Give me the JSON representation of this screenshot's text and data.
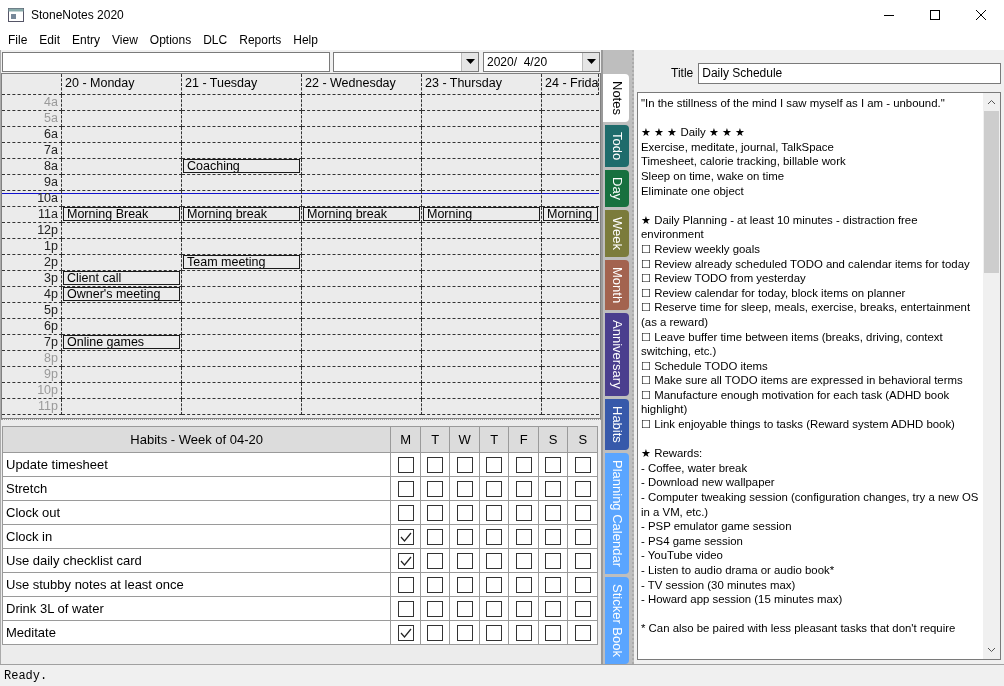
{
  "window": {
    "title": "StoneNotes 2020"
  },
  "menu": [
    "File",
    "Edit",
    "Entry",
    "View",
    "Options",
    "DLC",
    "Reports",
    "Help"
  ],
  "toolbar": {
    "date": "2020/  4/20"
  },
  "calendar": {
    "days": [
      "20 - Monday",
      "21 - Tuesday",
      "22 - Wednesday",
      "23 - Thursday",
      "24 - Frida"
    ],
    "rows": [
      {
        "time": "4a",
        "dimmed": true,
        "current": false,
        "slots": [
          {
            "kind": "empty"
          },
          {
            "kind": "empty"
          },
          {
            "kind": "empty"
          },
          {
            "kind": "empty"
          },
          {
            "kind": "empty"
          }
        ]
      },
      {
        "time": "5a",
        "dimmed": true,
        "current": false,
        "slots": [
          {
            "kind": "empty"
          },
          {
            "kind": "empty"
          },
          {
            "kind": "empty"
          },
          {
            "kind": "empty"
          },
          {
            "kind": "empty"
          }
        ]
      },
      {
        "time": "6a",
        "dimmed": false,
        "current": false,
        "slots": [
          {
            "kind": "empty"
          },
          {
            "kind": "empty"
          },
          {
            "kind": "empty"
          },
          {
            "kind": "empty"
          },
          {
            "kind": "empty"
          }
        ]
      },
      {
        "time": "7a",
        "dimmed": false,
        "current": false,
        "slots": [
          {
            "kind": "empty"
          },
          {
            "kind": "empty"
          },
          {
            "kind": "empty"
          },
          {
            "kind": "empty"
          },
          {
            "kind": "empty"
          }
        ]
      },
      {
        "time": "8a",
        "dimmed": false,
        "current": false,
        "slots": [
          {
            "kind": "empty"
          },
          {
            "kind": "event",
            "title": "Coaching"
          },
          {
            "kind": "empty"
          },
          {
            "kind": "empty"
          },
          {
            "kind": "empty"
          }
        ]
      },
      {
        "time": "9a",
        "dimmed": false,
        "current": false,
        "slots": [
          {
            "kind": "empty"
          },
          {
            "kind": "empty"
          },
          {
            "kind": "empty"
          },
          {
            "kind": "empty"
          },
          {
            "kind": "empty"
          }
        ]
      },
      {
        "time": "10a",
        "dimmed": false,
        "current": true,
        "slots": [
          {
            "kind": "empty"
          },
          {
            "kind": "empty"
          },
          {
            "kind": "empty"
          },
          {
            "kind": "empty"
          },
          {
            "kind": "empty"
          }
        ]
      },
      {
        "time": "11a",
        "dimmed": false,
        "current": false,
        "slots": [
          {
            "kind": "event",
            "title": "Morning Break"
          },
          {
            "kind": "event",
            "title": "Morning break"
          },
          {
            "kind": "event",
            "title": "Morning break"
          },
          {
            "kind": "event",
            "title": "Morning"
          },
          {
            "kind": "event",
            "title": "Morning"
          }
        ]
      },
      {
        "time": "12p",
        "dimmed": false,
        "current": false,
        "slots": [
          {
            "kind": "empty"
          },
          {
            "kind": "empty"
          },
          {
            "kind": "empty"
          },
          {
            "kind": "empty"
          },
          {
            "kind": "empty"
          }
        ]
      },
      {
        "time": "1p",
        "dimmed": false,
        "current": false,
        "slots": [
          {
            "kind": "empty"
          },
          {
            "kind": "empty"
          },
          {
            "kind": "empty"
          },
          {
            "kind": "empty"
          },
          {
            "kind": "empty"
          }
        ]
      },
      {
        "time": "2p",
        "dimmed": false,
        "current": false,
        "slots": [
          {
            "kind": "empty"
          },
          {
            "kind": "event",
            "title": "Team meeting"
          },
          {
            "kind": "empty"
          },
          {
            "kind": "empty"
          },
          {
            "kind": "empty"
          }
        ]
      },
      {
        "time": "3p",
        "dimmed": false,
        "current": false,
        "slots": [
          {
            "kind": "event",
            "title": "Client call"
          },
          {
            "kind": "empty"
          },
          {
            "kind": "empty"
          },
          {
            "kind": "empty"
          },
          {
            "kind": "empty"
          }
        ]
      },
      {
        "time": "4p",
        "dimmed": false,
        "current": false,
        "slots": [
          {
            "kind": "event",
            "title": "Owner's meeting"
          },
          {
            "kind": "empty"
          },
          {
            "kind": "empty"
          },
          {
            "kind": "empty"
          },
          {
            "kind": "empty"
          }
        ]
      },
      {
        "time": "5p",
        "dimmed": false,
        "current": false,
        "slots": [
          {
            "kind": "empty"
          },
          {
            "kind": "empty"
          },
          {
            "kind": "empty"
          },
          {
            "kind": "empty"
          },
          {
            "kind": "empty"
          }
        ]
      },
      {
        "time": "6p",
        "dimmed": false,
        "current": false,
        "slots": [
          {
            "kind": "empty"
          },
          {
            "kind": "empty"
          },
          {
            "kind": "empty"
          },
          {
            "kind": "empty"
          },
          {
            "kind": "empty"
          }
        ]
      },
      {
        "time": "7p",
        "dimmed": false,
        "current": false,
        "slots": [
          {
            "kind": "event",
            "title": "Online games"
          },
          {
            "kind": "empty"
          },
          {
            "kind": "empty"
          },
          {
            "kind": "empty"
          },
          {
            "kind": "empty"
          }
        ]
      },
      {
        "time": "8p",
        "dimmed": true,
        "current": false,
        "slots": [
          {
            "kind": "empty"
          },
          {
            "kind": "empty"
          },
          {
            "kind": "empty"
          },
          {
            "kind": "empty"
          },
          {
            "kind": "empty"
          }
        ]
      },
      {
        "time": "9p",
        "dimmed": true,
        "current": false,
        "slots": [
          {
            "kind": "empty"
          },
          {
            "kind": "empty"
          },
          {
            "kind": "empty"
          },
          {
            "kind": "empty"
          },
          {
            "kind": "empty"
          }
        ]
      },
      {
        "time": "10p",
        "dimmed": true,
        "current": false,
        "slots": [
          {
            "kind": "empty"
          },
          {
            "kind": "empty"
          },
          {
            "kind": "empty"
          },
          {
            "kind": "empty"
          },
          {
            "kind": "empty"
          }
        ]
      },
      {
        "time": "11p",
        "dimmed": true,
        "current": false,
        "slots": [
          {
            "kind": "empty"
          },
          {
            "kind": "empty"
          },
          {
            "kind": "empty"
          },
          {
            "kind": "empty"
          },
          {
            "kind": "empty"
          }
        ]
      }
    ]
  },
  "habits": {
    "title": "Habits - Week of 04-20",
    "days": [
      "M",
      "T",
      "W",
      "T",
      "F",
      "S",
      "S"
    ],
    "rows": [
      {
        "name": "Update timesheet",
        "checks": [
          false,
          false,
          false,
          false,
          false,
          false,
          false
        ]
      },
      {
        "name": "Stretch",
        "checks": [
          false,
          false,
          false,
          false,
          false,
          false,
          false
        ]
      },
      {
        "name": "Clock out",
        "checks": [
          false,
          false,
          false,
          false,
          false,
          false,
          false
        ]
      },
      {
        "name": "Clock in",
        "checks": [
          true,
          false,
          false,
          false,
          false,
          false,
          false
        ]
      },
      {
        "name": "Use daily checklist card",
        "checks": [
          true,
          false,
          false,
          false,
          false,
          false,
          false
        ]
      },
      {
        "name": "Use stubby notes at least once",
        "checks": [
          false,
          false,
          false,
          false,
          false,
          false,
          false
        ]
      },
      {
        "name": "Drink 3L of water",
        "checks": [
          false,
          false,
          false,
          false,
          false,
          false,
          false
        ]
      },
      {
        "name": "Meditate",
        "checks": [
          true,
          false,
          false,
          false,
          false,
          false,
          false
        ]
      }
    ]
  },
  "tabs": [
    {
      "label": "Notes",
      "selected": true
    },
    {
      "label": "Todo",
      "selected": false,
      "color": "#1e6b6b"
    },
    {
      "label": "Day",
      "selected": false,
      "color": "#17703f"
    },
    {
      "label": "Week",
      "selected": false,
      "color": "#7b7b3b"
    },
    {
      "label": "Month",
      "selected": false,
      "color": "#a3634f"
    },
    {
      "label": "Anniversary",
      "selected": false,
      "color": "#4a3e8e"
    },
    {
      "label": "Habits",
      "selected": false,
      "color": "#3759aa"
    },
    {
      "label": "Planning Calendar",
      "selected": false,
      "color": "#5aa5ff"
    },
    {
      "label": "Sticker Book",
      "selected": false,
      "color": "#5aa5ff"
    }
  ],
  "note": {
    "title_label": "Title",
    "title": "Daily Schedule",
    "blocks": [
      [
        "\"In the stillness of the mind I saw myself as I am - unbound.\""
      ],
      [
        "★ ★ ★  Daily ★ ★ ★",
        "Exercise, meditate, journal, TalkSpace",
        "Timesheet, calorie tracking, billable work",
        "Sleep on time, wake on time",
        "Eliminate one object"
      ],
      [
        "★ Daily Planning - at least 10 minutes - distraction free environment",
        "☐  Review weekly goals",
        "☐  Review already scheduled TODO and calendar items for today",
        "☐  Review TODO from yesterday",
        "☐  Review calendar for today, block items on planner",
        "☐  Reserve time for sleep, meals, exercise, breaks, entertainment (as a reward)",
        "☐  Leave buffer time between items (breaks, driving, context switching, etc.)",
        "☐  Schedule TODO items",
        "☐  Make sure all TODO items are expressed in behavioral terms",
        "☐  Manufacture enough motivation for each task (ADHD book highlight)",
        "☐  Link enjoyable things to tasks (Reward system ADHD book)"
      ],
      [
        "★ Rewards:",
        "- Coffee, water break",
        "- Download new wallpaper",
        "- Computer tweaking session (configuration changes, try a new OS in a VM, etc.)",
        "- PSP emulator game session",
        "- PS4 game session",
        "- YouTube video",
        "- Listen to audio drama or audio book*",
        "- TV session (30 minutes max)",
        "- Howard app session (15 minutes max)"
      ],
      [
        "* Can also be paired with less pleasant tasks that don't require"
      ]
    ]
  },
  "status_bar": "Ready."
}
